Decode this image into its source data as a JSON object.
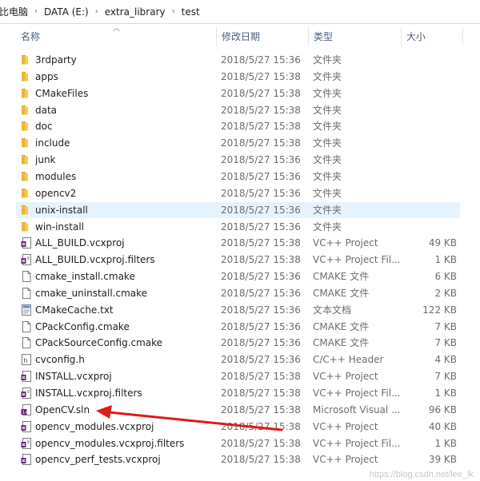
{
  "breadcrumb": [
    "比电脑",
    "DATA (E:)",
    "extra_library",
    "test"
  ],
  "columns": {
    "name": "名称",
    "date": "修改日期",
    "type": "类型",
    "size": "大小"
  },
  "files": [
    {
      "name": "3rdparty",
      "date": "2018/5/27 15:36",
      "type": "文件夹",
      "size": "",
      "icon": "folder-icon"
    },
    {
      "name": "apps",
      "date": "2018/5/27 15:38",
      "type": "文件夹",
      "size": "",
      "icon": "folder-icon"
    },
    {
      "name": "CMakeFiles",
      "date": "2018/5/27 15:38",
      "type": "文件夹",
      "size": "",
      "icon": "folder-icon"
    },
    {
      "name": "data",
      "date": "2018/5/27 15:38",
      "type": "文件夹",
      "size": "",
      "icon": "folder-icon"
    },
    {
      "name": "doc",
      "date": "2018/5/27 15:38",
      "type": "文件夹",
      "size": "",
      "icon": "folder-icon"
    },
    {
      "name": "include",
      "date": "2018/5/27 15:38",
      "type": "文件夹",
      "size": "",
      "icon": "folder-icon"
    },
    {
      "name": "junk",
      "date": "2018/5/27 15:36",
      "type": "文件夹",
      "size": "",
      "icon": "folder-icon"
    },
    {
      "name": "modules",
      "date": "2018/5/27 15:36",
      "type": "文件夹",
      "size": "",
      "icon": "folder-icon"
    },
    {
      "name": "opencv2",
      "date": "2018/5/27 15:36",
      "type": "文件夹",
      "size": "",
      "icon": "folder-icon"
    },
    {
      "name": "unix-install",
      "date": "2018/5/27 15:36",
      "type": "文件夹",
      "size": "",
      "icon": "folder-icon",
      "selected": true
    },
    {
      "name": "win-install",
      "date": "2018/5/27 15:36",
      "type": "文件夹",
      "size": "",
      "icon": "folder-icon"
    },
    {
      "name": "ALL_BUILD.vcxproj",
      "date": "2018/5/27 15:38",
      "type": "VC++ Project",
      "size": "49 KB",
      "icon": "vcxproj-icon"
    },
    {
      "name": "ALL_BUILD.vcxproj.filters",
      "date": "2018/5/27 15:38",
      "type": "VC++ Project Fil...",
      "size": "1 KB",
      "icon": "vcxproj-filters-icon"
    },
    {
      "name": "cmake_install.cmake",
      "date": "2018/5/27 15:36",
      "type": "CMAKE 文件",
      "size": "6 KB",
      "icon": "blank-file-icon"
    },
    {
      "name": "cmake_uninstall.cmake",
      "date": "2018/5/27 15:36",
      "type": "CMAKE 文件",
      "size": "2 KB",
      "icon": "blank-file-icon"
    },
    {
      "name": "CMakeCache.txt",
      "date": "2018/5/27 15:36",
      "type": "文本文档",
      "size": "122 KB",
      "icon": "text-file-icon"
    },
    {
      "name": "CPackConfig.cmake",
      "date": "2018/5/27 15:36",
      "type": "CMAKE 文件",
      "size": "7 KB",
      "icon": "blank-file-icon"
    },
    {
      "name": "CPackSourceConfig.cmake",
      "date": "2018/5/27 15:36",
      "type": "CMAKE 文件",
      "size": "7 KB",
      "icon": "blank-file-icon"
    },
    {
      "name": "cvconfig.h",
      "date": "2018/5/27 15:36",
      "type": "C/C++ Header",
      "size": "4 KB",
      "icon": "header-file-icon"
    },
    {
      "name": "INSTALL.vcxproj",
      "date": "2018/5/27 15:38",
      "type": "VC++ Project",
      "size": "7 KB",
      "icon": "vcxproj-icon"
    },
    {
      "name": "INSTALL.vcxproj.filters",
      "date": "2018/5/27 15:38",
      "type": "VC++ Project Fil...",
      "size": "1 KB",
      "icon": "vcxproj-filters-icon"
    },
    {
      "name": "OpenCV.sln",
      "date": "2018/5/27 15:38",
      "type": "Microsoft Visual ...",
      "size": "96 KB",
      "icon": "sln-file-icon"
    },
    {
      "name": "opencv_modules.vcxproj",
      "date": "2018/5/27 15:38",
      "type": "VC++ Project",
      "size": "40 KB",
      "icon": "vcxproj-icon"
    },
    {
      "name": "opencv_modules.vcxproj.filters",
      "date": "2018/5/27 15:38",
      "type": "VC++ Project Fil...",
      "size": "1 KB",
      "icon": "vcxproj-filters-icon"
    },
    {
      "name": "opencv_perf_tests.vcxproj",
      "date": "2018/5/27 15:38",
      "type": "VC++ Project",
      "size": "39 KB",
      "icon": "vcxproj-icon"
    }
  ],
  "watermark": "https://blog.csdn.net/lee_lk",
  "annotation_arrow_color": "#e01a1a",
  "selection_color": "#e5f3ff",
  "folder_color": "#f7c948"
}
